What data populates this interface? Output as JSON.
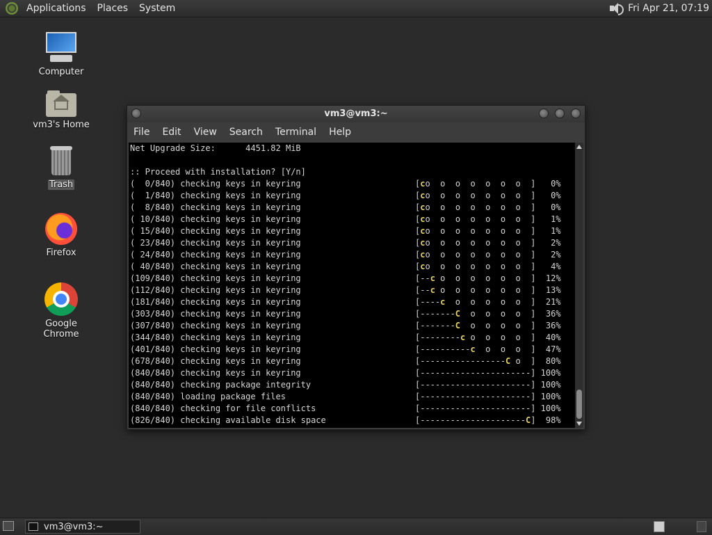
{
  "top_panel": {
    "menus": [
      "Applications",
      "Places",
      "System"
    ],
    "clock": "Fri Apr 21, 07:19"
  },
  "desktop": {
    "icons": [
      {
        "label": "Computer",
        "icon": "computer-icon"
      },
      {
        "label": "vm3's Home",
        "icon": "home-folder-icon"
      },
      {
        "label": "Trash",
        "icon": "trash-icon"
      },
      {
        "label": "Firefox",
        "icon": "firefox-icon"
      },
      {
        "label": "Google Chrome",
        "icon": "chrome-icon"
      }
    ]
  },
  "window": {
    "title": "vm3@vm3:~",
    "menu": [
      "File",
      "Edit",
      "View",
      "Search",
      "Terminal",
      "Help"
    ]
  },
  "terminal": {
    "lines": [
      {
        "left": "Net Upgrade Size:      4451.82 MiB",
        "pre": "",
        "pac": "",
        "post": ""
      },
      {
        "left": "",
        "pre": "",
        "pac": "",
        "post": ""
      },
      {
        "left": ":: Proceed with installation? [Y/n]",
        "pre": "",
        "pac": "",
        "post": ""
      },
      {
        "left": "(  0/840) checking keys in keyring",
        "pre": "[",
        "pac": "c",
        "post": "o  o  o  o  o  o  o  ]   0%"
      },
      {
        "left": "(  1/840) checking keys in keyring",
        "pre": "[",
        "pac": "c",
        "post": "o  o  o  o  o  o  o  ]   0%"
      },
      {
        "left": "(  8/840) checking keys in keyring",
        "pre": "[",
        "pac": "c",
        "post": "o  o  o  o  o  o  o  ]   0%"
      },
      {
        "left": "( 10/840) checking keys in keyring",
        "pre": "[",
        "pac": "c",
        "post": "o  o  o  o  o  o  o  ]   1%"
      },
      {
        "left": "( 15/840) checking keys in keyring",
        "pre": "[",
        "pac": "c",
        "post": "o  o  o  o  o  o  o  ]   1%"
      },
      {
        "left": "( 23/840) checking keys in keyring",
        "pre": "[",
        "pac": "c",
        "post": "o  o  o  o  o  o  o  ]   2%"
      },
      {
        "left": "( 24/840) checking keys in keyring",
        "pre": "[",
        "pac": "c",
        "post": "o  o  o  o  o  o  o  ]   2%"
      },
      {
        "left": "( 40/840) checking keys in keyring",
        "pre": "[",
        "pac": "c",
        "post": "o  o  o  o  o  o  o  ]   4%"
      },
      {
        "left": "(109/840) checking keys in keyring",
        "pre": "[--",
        "pac": "c",
        "post": " o  o  o  o  o  o  ]  12%"
      },
      {
        "left": "(112/840) checking keys in keyring",
        "pre": "[--",
        "pac": "c",
        "post": " o  o  o  o  o  o  ]  13%"
      },
      {
        "left": "(181/840) checking keys in keyring",
        "pre": "[----",
        "pac": "c",
        "post": "  o  o  o  o  o  ]  21%"
      },
      {
        "left": "(303/840) checking keys in keyring",
        "pre": "[-------",
        "pac": "C",
        "post": "  o  o  o  o  ]  36%"
      },
      {
        "left": "(307/840) checking keys in keyring",
        "pre": "[-------",
        "pac": "C",
        "post": "  o  o  o  o  ]  36%"
      },
      {
        "left": "(344/840) checking keys in keyring",
        "pre": "[--------",
        "pac": "c",
        "post": " o  o  o  o  ]  40%"
      },
      {
        "left": "(401/840) checking keys in keyring",
        "pre": "[----------",
        "pac": "c",
        "post": "  o  o  o  ]  47%"
      },
      {
        "left": "(678/840) checking keys in keyring",
        "pre": "[-----------------",
        "pac": "C",
        "post": " o  ]  80%"
      },
      {
        "left": "(840/840) checking keys in keyring",
        "pre": "[----------------------]",
        "pac": "",
        "post": " 100%"
      },
      {
        "left": "(840/840) checking package integrity",
        "pre": "[----------------------]",
        "pac": "",
        "post": " 100%"
      },
      {
        "left": "(840/840) loading package files",
        "pre": "[----------------------]",
        "pac": "",
        "post": " 100%"
      },
      {
        "left": "(840/840) checking for file conflicts",
        "pre": "[----------------------]",
        "pac": "",
        "post": " 100%"
      },
      {
        "left": "(826/840) checking available disk space",
        "pre": "[---------------------",
        "pac": "C",
        "post": "]  98%"
      }
    ]
  },
  "bottom_panel": {
    "task_label": "vm3@vm3:~"
  },
  "colors": {
    "desktop_bg": "#2a2b2a",
    "terminal_bg": "#000000",
    "terminal_fg": "#d6d6d6",
    "pacman": "#e5d36a"
  }
}
